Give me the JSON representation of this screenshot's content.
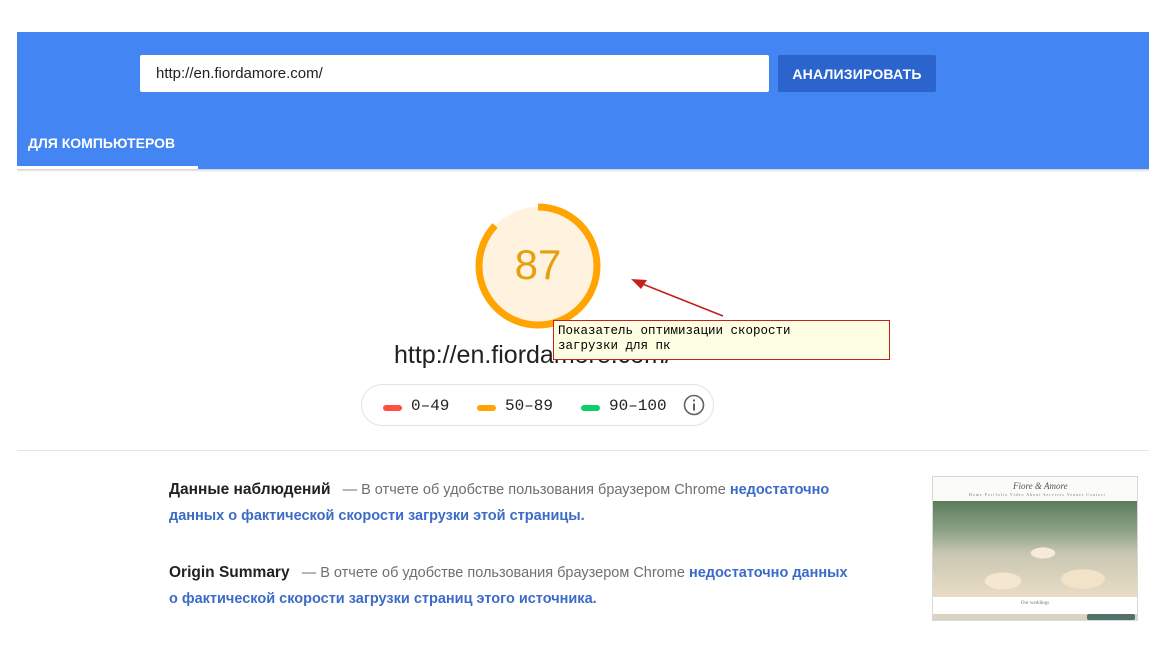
{
  "header": {
    "url_value": "http://en.fiordamore.com/",
    "analyze_label": "АНАЛИЗИРОВАТЬ",
    "tab_label": "ДЛЯ КОМПЬЮТЕРОВ"
  },
  "score": {
    "value": "87",
    "fraction": 0.87,
    "color": "#ffa400",
    "track_color": "#fff3e0"
  },
  "page_url": "http://en.fiordamore.com/",
  "annotation": {
    "line1": "Показатель оптимизации скорости",
    "line2": "загрузки для пк",
    "border_color": "#c81e1e"
  },
  "legend": [
    {
      "range": "0–49",
      "color": "#ff4e42"
    },
    {
      "range": "50–89",
      "color": "#ffa400"
    },
    {
      "range": "90–100",
      "color": "#0cce6b"
    }
  ],
  "sections": [
    {
      "title": "Данные наблюдений",
      "dash": "—",
      "text": "В отчете об удобстве пользования браузером Chrome",
      "link_a": "недостаточно",
      "link_b": "данных о фактической скорости загрузки этой страницы."
    },
    {
      "title": "Origin Summary",
      "dash": "—",
      "text": "В отчете об удобстве пользования браузером Chrome",
      "link_a": "недостаточно данных",
      "link_b": "о фактической скорости загрузки страниц этого источника."
    }
  ],
  "thumbnail": {
    "logo": "Fiore & Amore",
    "nav": "Home  Portfolio  Video  About  Services  Venues  Contact",
    "caption": "Our weddings"
  }
}
